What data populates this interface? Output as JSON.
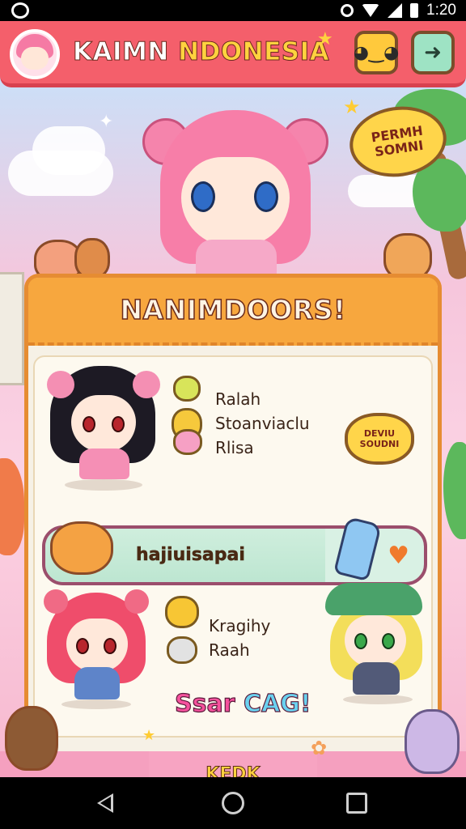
{
  "status_bar": {
    "time": "1:20",
    "icons": [
      "app-notification-icon",
      "alarm-icon",
      "wifi-icon",
      "signal-icon",
      "battery-icon"
    ]
  },
  "header": {
    "title_part1": "KAIMN",
    "title_part2": "NDONESIA",
    "buttons": [
      "face-icon",
      "next-arrow-icon"
    ]
  },
  "speech_bubble_top": "PERMH SOMNI",
  "panel": {
    "title": "NANIMDOORS!",
    "row1": {
      "line1": "Ralah",
      "line2": "Stoanviaclu",
      "line3": "Rlisa",
      "badge": "DEVIU SOUDNI"
    },
    "progress": {
      "label": "hajiuisapai",
      "value_fraction": 0.74
    },
    "row2": {
      "line1": "Kragihy",
      "line2": "Raah",
      "cta_part1": "Ssar",
      "cta_part2": "CAG!"
    }
  },
  "bottom": {
    "ok_label": "KEDK"
  },
  "colors": {
    "header_red": "#f45f6b",
    "panel_orange": "#f7a73e",
    "accent_yellow": "#ffd23f",
    "accent_pink": "#f5529d",
    "accent_cyan": "#6ad1ef"
  }
}
